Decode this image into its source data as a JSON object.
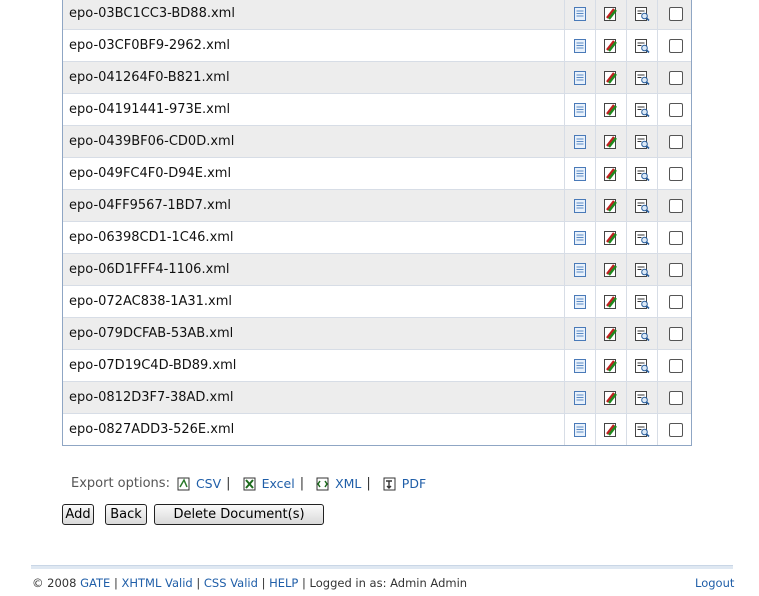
{
  "documents": [
    "epo-03BC1CC3-BD88.xml",
    "epo-03CF0BF9-2962.xml",
    "epo-041264F0-B821.xml",
    "epo-04191441-973E.xml",
    "epo-0439BF06-CD0D.xml",
    "epo-049FC4F0-D94E.xml",
    "epo-04FF9567-1BD7.xml",
    "epo-06398CD1-1C46.xml",
    "epo-06D1FFF4-1106.xml",
    "epo-072AC838-1A31.xml",
    "epo-079DCFAB-53AB.xml",
    "epo-07D19C4D-BD89.xml",
    "epo-0812D3F7-38AD.xml",
    "epo-0827ADD3-526E.xml"
  ],
  "row_icons": [
    "document-icon",
    "edit-icon",
    "view-icon"
  ],
  "export": {
    "label": "Export options:",
    "csv": "CSV",
    "excel": "Excel",
    "xml": "XML",
    "pdf": "PDF"
  },
  "buttons": {
    "add": "Add",
    "back": "Back",
    "delete": "Delete Document(s)"
  },
  "footer": {
    "copyright": "© 2008",
    "gate": "GATE",
    "xhtml": "XHTML Valid",
    "css": "CSS Valid",
    "help": "HELP",
    "logged_in": "Logged in as: Admin Admin",
    "logout": "Logout"
  },
  "colors": {
    "link": "#1f5ea8",
    "table_border": "#8fa6c4",
    "row_alt": "#ededed"
  }
}
